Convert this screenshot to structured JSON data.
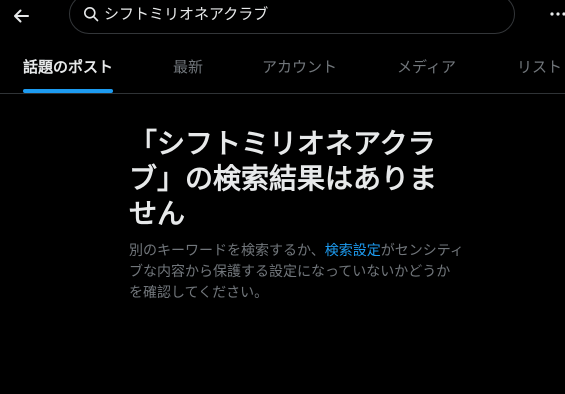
{
  "header": {
    "search_query": "シフトミリオネアクラブ"
  },
  "tabs": [
    {
      "label": "話題のポスト",
      "active": true
    },
    {
      "label": "最新",
      "active": false
    },
    {
      "label": "アカウント",
      "active": false
    },
    {
      "label": "メディア",
      "active": false
    },
    {
      "label": "リスト",
      "active": false
    }
  ],
  "empty_state": {
    "title": "「シフトミリオネアクラブ」の検索結果はありません",
    "desc_before": "別のキーワードを検索するか、",
    "desc_link": "検索設定",
    "desc_after": "がセンシティブな内容から保護する設定になっていないかどうかを確認してください。"
  },
  "colors": {
    "background": "#000000",
    "accent": "#1d9bf0",
    "text_primary": "#e7e9ea",
    "text_secondary": "#71767b",
    "border": "#2f3336"
  },
  "icons": {
    "back": "arrow-left-icon",
    "search": "search-icon",
    "more": "more-icon"
  }
}
